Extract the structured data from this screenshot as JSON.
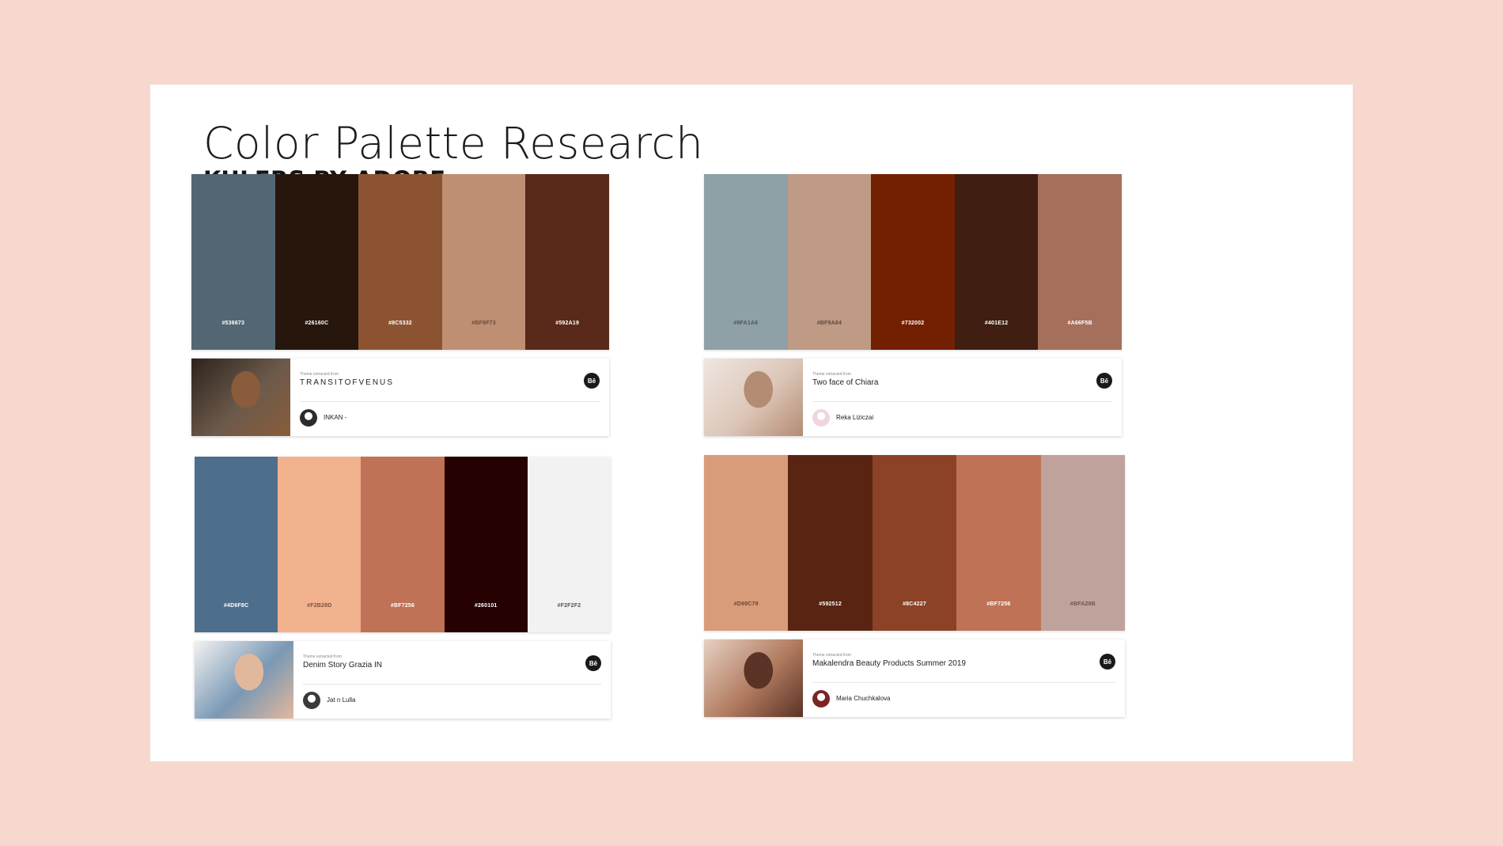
{
  "page": {
    "title": "Color Palette Research",
    "subtitle": "KULERS BY ADOBE"
  },
  "palettes": [
    {
      "swatches": [
        {
          "hex": "#536673",
          "label": "#536673",
          "label_color": "#ffffff"
        },
        {
          "hex": "#26160C",
          "label": "#26160C",
          "label_color": "#ffffff"
        },
        {
          "hex": "#8C5332",
          "label": "#8C5332",
          "label_color": "#ffffff"
        },
        {
          "hex": "#BF8F73",
          "label": "#BF8F73",
          "label_color": "#6b4a38"
        },
        {
          "hex": "#592A19",
          "label": "#592A19",
          "label_color": "#ffffff"
        }
      ],
      "extracted_label": "Theme extracted from",
      "theme_name": "TRANSITOFVENUS",
      "author": "INKAN -",
      "behance_label": "Bē",
      "thumb_colors": [
        "#6c5a4b",
        "#8a5c3b",
        "#2d231d"
      ],
      "avatar_color": "#2c2c2c"
    },
    {
      "swatches": [
        {
          "hex": "#8FA1A6",
          "label": "#8FA1A6",
          "label_color": "#4a5558"
        },
        {
          "hex": "#BF9A84",
          "label": "#BF9A84",
          "label_color": "#5f4a3e"
        },
        {
          "hex": "#732002",
          "label": "#732002",
          "label_color": "#ffffff"
        },
        {
          "hex": "#401E12",
          "label": "#401E12",
          "label_color": "#ffffff"
        },
        {
          "hex": "#A66F5B",
          "label": "#A66F5B",
          "label_color": "#ffffff"
        }
      ],
      "extracted_label": "Theme extracted from",
      "theme_name": "Two face of Chiara",
      "author": "Reka Liziczai",
      "behance_label": "Bē",
      "thumb_colors": [
        "#dcc6b8",
        "#b48b73",
        "#efe6e0"
      ],
      "avatar_color": "#f0d5dc"
    },
    {
      "swatches": [
        {
          "hex": "#4D6F8C",
          "label": "#4D6F8C",
          "label_color": "#ffffff"
        },
        {
          "hex": "#F2B28D",
          "label": "#F2B28D",
          "label_color": "#7a5340"
        },
        {
          "hex": "#BF7256",
          "label": "#BF7256",
          "label_color": "#ffffff"
        },
        {
          "hex": "#260101",
          "label": "#260101",
          "label_color": "#ffffff"
        },
        {
          "hex": "#F2F2F2",
          "label": "#F2F2F2",
          "label_color": "#555555"
        }
      ],
      "extracted_label": "Theme extracted from",
      "theme_name": "Denim Story Grazia IN",
      "author": "Jat n Lulla",
      "behance_label": "Bē",
      "thumb_colors": [
        "#7a98b5",
        "#e2b89c",
        "#f2f2f2"
      ],
      "avatar_color": "#3a3a3a"
    },
    {
      "swatches": [
        {
          "hex": "#D99C79",
          "label": "#D99C79",
          "label_color": "#6b4632"
        },
        {
          "hex": "#592512",
          "label": "#592512",
          "label_color": "#ffffff"
        },
        {
          "hex": "#8C4227",
          "label": "#8C4227",
          "label_color": "#ffffff"
        },
        {
          "hex": "#BF7256",
          "label": "#BF7256",
          "label_color": "#ffffff"
        },
        {
          "hex": "#BFA29B",
          "label": "#BFA29B",
          "label_color": "#6b5650"
        }
      ],
      "extracted_label": "Theme extracted from",
      "theme_name": "Makalendra Beauty Products Summer 2019",
      "author": "Maria Chuchkalova",
      "behance_label": "Bē",
      "thumb_colors": [
        "#b07a5e",
        "#5a3226",
        "#e7d0c3"
      ],
      "avatar_color": "#7a2424"
    }
  ]
}
